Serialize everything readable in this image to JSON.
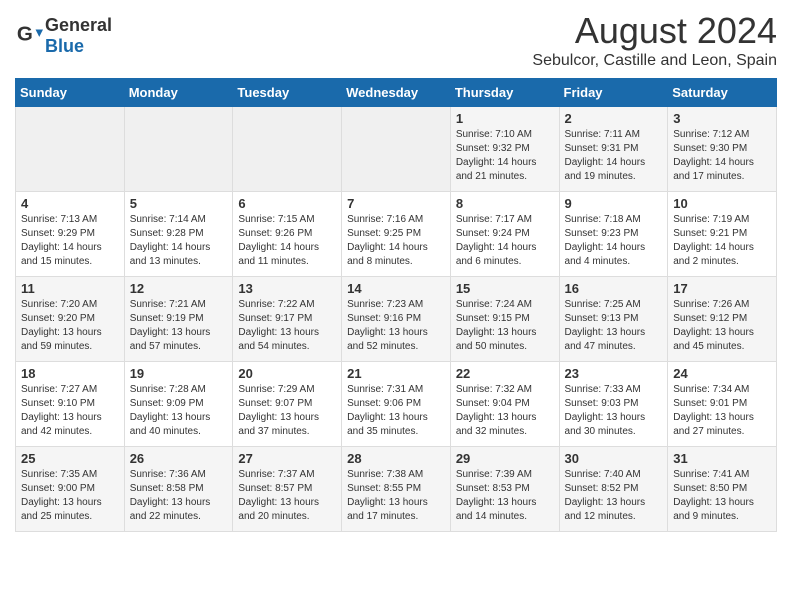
{
  "header": {
    "logo_general": "General",
    "logo_blue": "Blue",
    "month_year": "August 2024",
    "location": "Sebulcor, Castille and Leon, Spain"
  },
  "weekdays": [
    "Sunday",
    "Monday",
    "Tuesday",
    "Wednesday",
    "Thursday",
    "Friday",
    "Saturday"
  ],
  "weeks": [
    [
      {
        "day": "",
        "empty": true
      },
      {
        "day": "",
        "empty": true
      },
      {
        "day": "",
        "empty": true
      },
      {
        "day": "",
        "empty": true
      },
      {
        "day": "1",
        "sunrise": "Sunrise: 7:10 AM",
        "sunset": "Sunset: 9:32 PM",
        "daylight": "Daylight: 14 hours and 21 minutes."
      },
      {
        "day": "2",
        "sunrise": "Sunrise: 7:11 AM",
        "sunset": "Sunset: 9:31 PM",
        "daylight": "Daylight: 14 hours and 19 minutes."
      },
      {
        "day": "3",
        "sunrise": "Sunrise: 7:12 AM",
        "sunset": "Sunset: 9:30 PM",
        "daylight": "Daylight: 14 hours and 17 minutes."
      }
    ],
    [
      {
        "day": "4",
        "sunrise": "Sunrise: 7:13 AM",
        "sunset": "Sunset: 9:29 PM",
        "daylight": "Daylight: 14 hours and 15 minutes."
      },
      {
        "day": "5",
        "sunrise": "Sunrise: 7:14 AM",
        "sunset": "Sunset: 9:28 PM",
        "daylight": "Daylight: 14 hours and 13 minutes."
      },
      {
        "day": "6",
        "sunrise": "Sunrise: 7:15 AM",
        "sunset": "Sunset: 9:26 PM",
        "daylight": "Daylight: 14 hours and 11 minutes."
      },
      {
        "day": "7",
        "sunrise": "Sunrise: 7:16 AM",
        "sunset": "Sunset: 9:25 PM",
        "daylight": "Daylight: 14 hours and 8 minutes."
      },
      {
        "day": "8",
        "sunrise": "Sunrise: 7:17 AM",
        "sunset": "Sunset: 9:24 PM",
        "daylight": "Daylight: 14 hours and 6 minutes."
      },
      {
        "day": "9",
        "sunrise": "Sunrise: 7:18 AM",
        "sunset": "Sunset: 9:23 PM",
        "daylight": "Daylight: 14 hours and 4 minutes."
      },
      {
        "day": "10",
        "sunrise": "Sunrise: 7:19 AM",
        "sunset": "Sunset: 9:21 PM",
        "daylight": "Daylight: 14 hours and 2 minutes."
      }
    ],
    [
      {
        "day": "11",
        "sunrise": "Sunrise: 7:20 AM",
        "sunset": "Sunset: 9:20 PM",
        "daylight": "Daylight: 13 hours and 59 minutes."
      },
      {
        "day": "12",
        "sunrise": "Sunrise: 7:21 AM",
        "sunset": "Sunset: 9:19 PM",
        "daylight": "Daylight: 13 hours and 57 minutes."
      },
      {
        "day": "13",
        "sunrise": "Sunrise: 7:22 AM",
        "sunset": "Sunset: 9:17 PM",
        "daylight": "Daylight: 13 hours and 54 minutes."
      },
      {
        "day": "14",
        "sunrise": "Sunrise: 7:23 AM",
        "sunset": "Sunset: 9:16 PM",
        "daylight": "Daylight: 13 hours and 52 minutes."
      },
      {
        "day": "15",
        "sunrise": "Sunrise: 7:24 AM",
        "sunset": "Sunset: 9:15 PM",
        "daylight": "Daylight: 13 hours and 50 minutes."
      },
      {
        "day": "16",
        "sunrise": "Sunrise: 7:25 AM",
        "sunset": "Sunset: 9:13 PM",
        "daylight": "Daylight: 13 hours and 47 minutes."
      },
      {
        "day": "17",
        "sunrise": "Sunrise: 7:26 AM",
        "sunset": "Sunset: 9:12 PM",
        "daylight": "Daylight: 13 hours and 45 minutes."
      }
    ],
    [
      {
        "day": "18",
        "sunrise": "Sunrise: 7:27 AM",
        "sunset": "Sunset: 9:10 PM",
        "daylight": "Daylight: 13 hours and 42 minutes."
      },
      {
        "day": "19",
        "sunrise": "Sunrise: 7:28 AM",
        "sunset": "Sunset: 9:09 PM",
        "daylight": "Daylight: 13 hours and 40 minutes."
      },
      {
        "day": "20",
        "sunrise": "Sunrise: 7:29 AM",
        "sunset": "Sunset: 9:07 PM",
        "daylight": "Daylight: 13 hours and 37 minutes."
      },
      {
        "day": "21",
        "sunrise": "Sunrise: 7:31 AM",
        "sunset": "Sunset: 9:06 PM",
        "daylight": "Daylight: 13 hours and 35 minutes."
      },
      {
        "day": "22",
        "sunrise": "Sunrise: 7:32 AM",
        "sunset": "Sunset: 9:04 PM",
        "daylight": "Daylight: 13 hours and 32 minutes."
      },
      {
        "day": "23",
        "sunrise": "Sunrise: 7:33 AM",
        "sunset": "Sunset: 9:03 PM",
        "daylight": "Daylight: 13 hours and 30 minutes."
      },
      {
        "day": "24",
        "sunrise": "Sunrise: 7:34 AM",
        "sunset": "Sunset: 9:01 PM",
        "daylight": "Daylight: 13 hours and 27 minutes."
      }
    ],
    [
      {
        "day": "25",
        "sunrise": "Sunrise: 7:35 AM",
        "sunset": "Sunset: 9:00 PM",
        "daylight": "Daylight: 13 hours and 25 minutes."
      },
      {
        "day": "26",
        "sunrise": "Sunrise: 7:36 AM",
        "sunset": "Sunset: 8:58 PM",
        "daylight": "Daylight: 13 hours and 22 minutes."
      },
      {
        "day": "27",
        "sunrise": "Sunrise: 7:37 AM",
        "sunset": "Sunset: 8:57 PM",
        "daylight": "Daylight: 13 hours and 20 minutes."
      },
      {
        "day": "28",
        "sunrise": "Sunrise: 7:38 AM",
        "sunset": "Sunset: 8:55 PM",
        "daylight": "Daylight: 13 hours and 17 minutes."
      },
      {
        "day": "29",
        "sunrise": "Sunrise: 7:39 AM",
        "sunset": "Sunset: 8:53 PM",
        "daylight": "Daylight: 13 hours and 14 minutes."
      },
      {
        "day": "30",
        "sunrise": "Sunrise: 7:40 AM",
        "sunset": "Sunset: 8:52 PM",
        "daylight": "Daylight: 13 hours and 12 minutes."
      },
      {
        "day": "31",
        "sunrise": "Sunrise: 7:41 AM",
        "sunset": "Sunset: 8:50 PM",
        "daylight": "Daylight: 13 hours and 9 minutes."
      }
    ]
  ]
}
